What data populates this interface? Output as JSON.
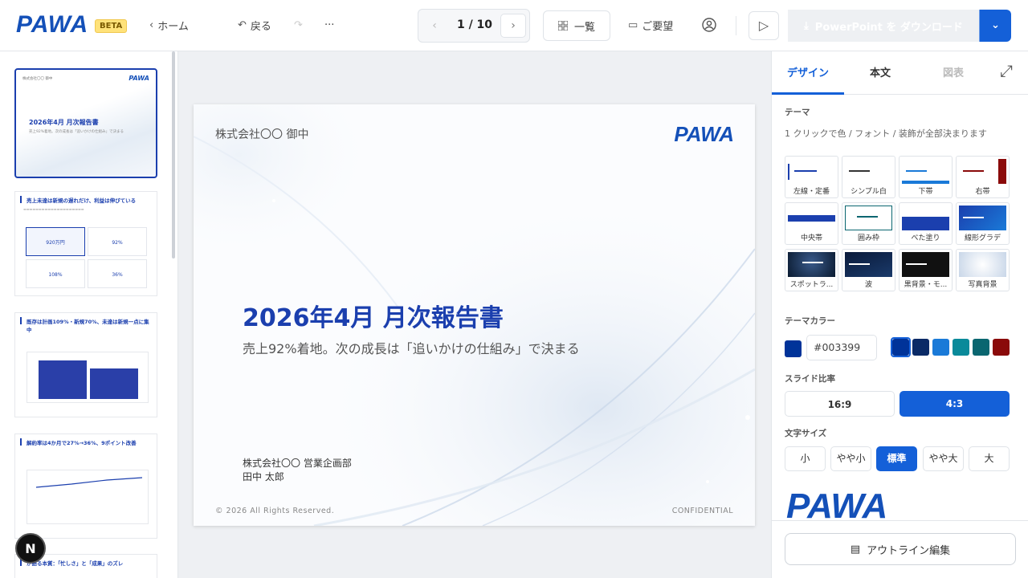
{
  "header": {
    "logo": "PAWA",
    "beta": "BETA",
    "home": "ホーム",
    "back": "戻る",
    "more": "···",
    "pager": "1 / 10",
    "list": "一覧",
    "request": "ご要望",
    "download": "PowerPoint を ダウンロード"
  },
  "slide": {
    "client": "株式会社〇〇 御中",
    "logo": "PAWA",
    "title": "2026年4月 月次報告書",
    "subtitle": "売上92%着地。次の成長は「追いかけの仕組み」で決まる",
    "org": "株式会社〇〇 営業企画部",
    "author": "田中 太郎",
    "copyright": "© 2026 All Rights Reserved.",
    "confidential": "CONFIDENTIAL"
  },
  "thumbs": {
    "t1": {
      "client": "株式会社〇〇 御中",
      "logo": "PAWA",
      "title": "2026年4月 月次報告書",
      "sub": "売上92%着地。次の成長は「追いかけの仕組み」で決まる"
    },
    "t2": {
      "title": "売上未達は新規の遅れだけ、利益は伸びている",
      "k1": "920万円",
      "k2": "92%",
      "k3": "108%",
      "k4": "36%"
    },
    "t3": {
      "title": "既存は計画109%・新規70%、未達は新規一点に集中"
    },
    "t4": {
      "title": "解約率は4か月で27%→36%、9ポイント改善"
    },
    "t5": {
      "title": "が語る本質：「忙しさ」と「成果」のズレ"
    }
  },
  "panel": {
    "tabs": [
      "デザイン",
      "本文",
      "図表"
    ],
    "theme_title": "テーマ",
    "theme_desc": "1 クリックで色 / フォント / 装飾が全部決まります",
    "themes": [
      "左線・定番",
      "シンプル白",
      "下帯",
      "右帯",
      "中央帯",
      "囲み枠",
      "べた塗り",
      "線形グラデ",
      "スポットラ...",
      "波",
      "黒背景・モ...",
      "写真背景"
    ],
    "color_title": "テーマカラー",
    "color_value": "#003399",
    "colors": [
      "#003399",
      "#0a2a66",
      "#1a7ad8",
      "#0a8a9a",
      "#0a6670",
      "#8a0a0a"
    ],
    "ratio_title": "スライド比率",
    "ratios": [
      "16:9",
      "4:3"
    ],
    "size_title": "文字サイズ",
    "sizes": [
      "小",
      "やや小",
      "標準",
      "やや大",
      "大"
    ],
    "preview_logo": "PAWA",
    "outline": "アウトライン編集"
  },
  "badge": "N"
}
